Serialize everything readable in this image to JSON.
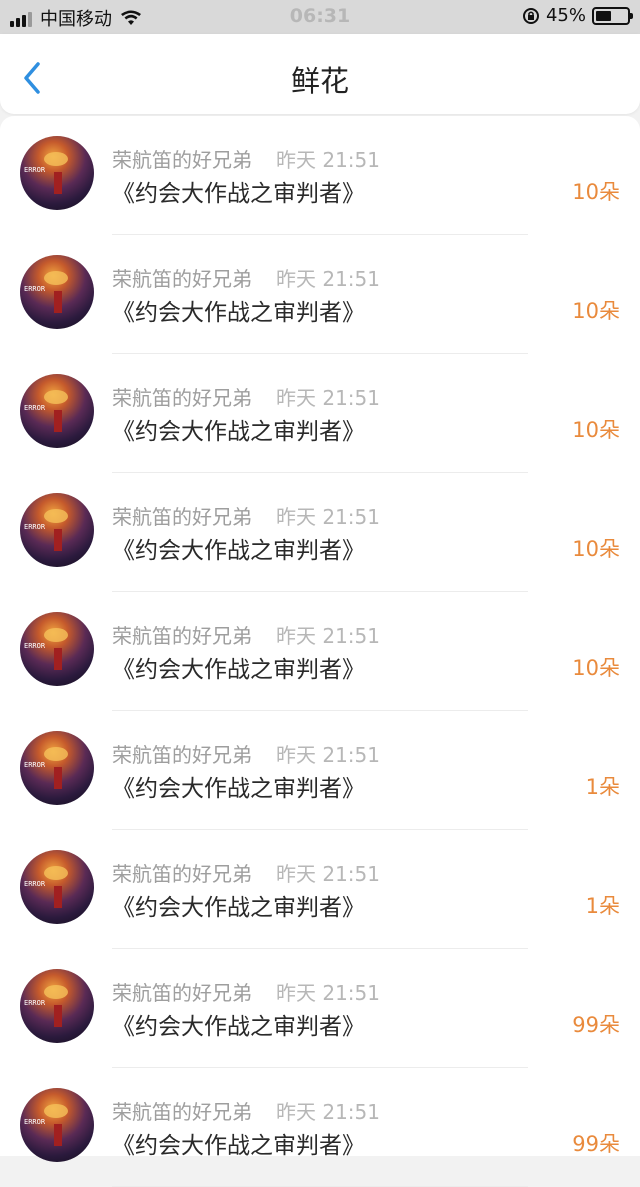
{
  "status_bar": {
    "carrier": "中国移动",
    "time": "06:31",
    "battery_percent": "45%",
    "battery_level": 0.45
  },
  "header": {
    "title": "鲜花",
    "back_icon": "chevron-left-icon"
  },
  "records": [
    {
      "user": "荣航笛的好兄弟",
      "time": "昨天 21:51",
      "work": "《约会大作战之审判者》",
      "count": "10朵"
    },
    {
      "user": "荣航笛的好兄弟",
      "time": "昨天 21:51",
      "work": "《约会大作战之审判者》",
      "count": "10朵"
    },
    {
      "user": "荣航笛的好兄弟",
      "time": "昨天 21:51",
      "work": "《约会大作战之审判者》",
      "count": "10朵"
    },
    {
      "user": "荣航笛的好兄弟",
      "time": "昨天 21:51",
      "work": "《约会大作战之审判者》",
      "count": "10朵"
    },
    {
      "user": "荣航笛的好兄弟",
      "time": "昨天 21:51",
      "work": "《约会大作战之审判者》",
      "count": "10朵"
    },
    {
      "user": "荣航笛的好兄弟",
      "time": "昨天 21:51",
      "work": "《约会大作战之审判者》",
      "count": "1朵"
    },
    {
      "user": "荣航笛的好兄弟",
      "time": "昨天 21:51",
      "work": "《约会大作战之审判者》",
      "count": "1朵"
    },
    {
      "user": "荣航笛的好兄弟",
      "time": "昨天 21:51",
      "work": "《约会大作战之审判者》",
      "count": "99朵"
    },
    {
      "user": "荣航笛的好兄弟",
      "time": "昨天 21:51",
      "work": "《约会大作战之审判者》",
      "count": "99朵"
    }
  ],
  "colors": {
    "accent": "#2f8fe0",
    "count": "#e98a3c",
    "muted": "#9e9e9e"
  }
}
